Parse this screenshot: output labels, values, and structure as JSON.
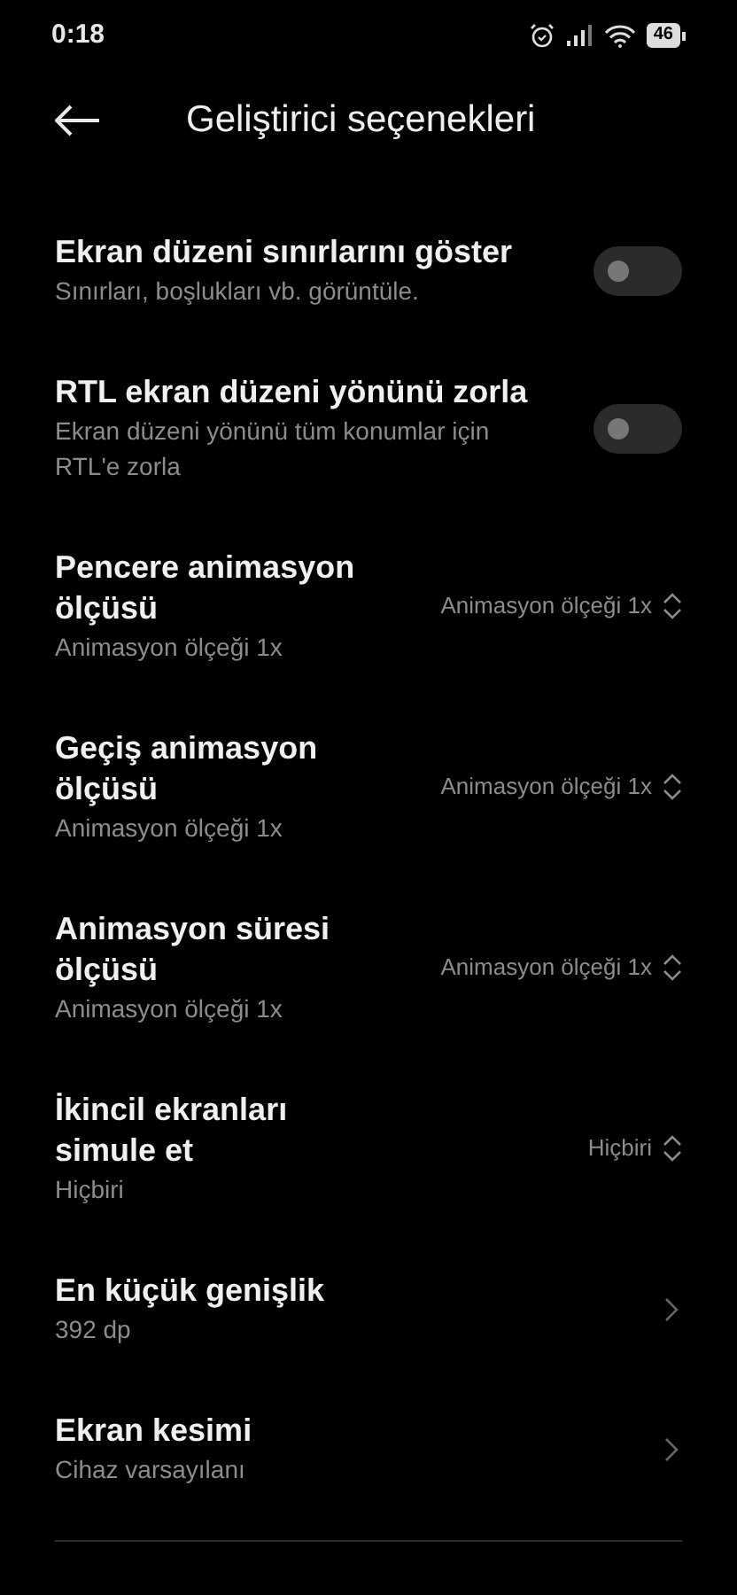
{
  "status_bar": {
    "time": "0:18",
    "battery": "46"
  },
  "header": {
    "title": "Geliştirici seçenekleri"
  },
  "settings": [
    {
      "kind": "toggle",
      "title": "Ekran düzeni sınırlarını göster",
      "subtitle": "Sınırları, boşlukları vb. görüntüle.",
      "on": false
    },
    {
      "kind": "toggle",
      "title": "RTL ekran düzeni yönünü zorla",
      "subtitle": "Ekran düzeni yönünü tüm konumlar için RTL'e zorla",
      "on": false
    },
    {
      "kind": "select",
      "title": "Pencere animasyon ölçüsü",
      "subtitle": "Animasyon ölçeği 1x",
      "value": "Animasyon ölçeği 1x"
    },
    {
      "kind": "select",
      "title": "Geçiş animasyon ölçüsü",
      "subtitle": "Animasyon ölçeği 1x",
      "value": "Animasyon ölçeği 1x"
    },
    {
      "kind": "select",
      "title": "Animasyon süresi ölçüsü",
      "subtitle": "Animasyon ölçeği 1x",
      "value": "Animasyon ölçeği 1x"
    },
    {
      "kind": "select",
      "title": "İkincil ekranları simule et",
      "subtitle": "Hiçbiri",
      "value": "Hiçbiri"
    },
    {
      "kind": "link",
      "title": "En küçük genişlik",
      "subtitle": "392 dp"
    },
    {
      "kind": "link",
      "title": "Ekran kesimi",
      "subtitle": "Cihaz varsayılanı"
    }
  ]
}
